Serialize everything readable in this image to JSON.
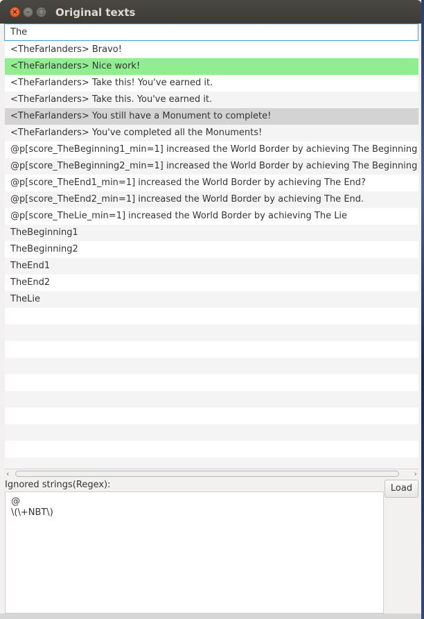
{
  "window": {
    "title": "Original texts",
    "close_glyph": "×",
    "minimize_glyph": "–",
    "maximize_glyph": "□"
  },
  "filter": {
    "value": "The"
  },
  "list": {
    "items": [
      "<TheFarlanders> Bravo!",
      "<TheFarlanders> Nice work!",
      "<TheFarlanders> Take this! You've earned it.",
      "<TheFarlanders> Take this. You've earned it.",
      "<TheFarlanders> You still have a Monument to complete!",
      "<TheFarlanders> You've completed all the Monuments!",
      "@p[score_TheBeginning1_min=1] increased the World Border by achieving The Beginning",
      "@p[score_TheBeginning2_min=1] increased the World Border by achieving The Beginning",
      "@p[score_TheEnd1_min=1] increased the World Border by achieving The End?",
      "@p[score_TheEnd2_min=1] increased the World Border by achieving The End.",
      "@p[score_TheLie_min=1] increased the World Border by achieving The Lie",
      "TheBeginning1",
      "TheBeginning2",
      "TheEnd1",
      "TheEnd2",
      "TheLie"
    ],
    "selected_index": 1,
    "hover_index": 4,
    "colors": {
      "selected": "#90ee90",
      "hover": "#d3d3d3",
      "odd": "#ffffff",
      "even": "#f4f4f4"
    }
  },
  "ignored": {
    "label": "Ignored strings(Regex):",
    "lines": [
      "@",
      "\\(\\+NBT\\)"
    ]
  },
  "load_button": {
    "label": "Load"
  },
  "scrollbar": {
    "left_glyph": "‹",
    "right_glyph": "›"
  }
}
